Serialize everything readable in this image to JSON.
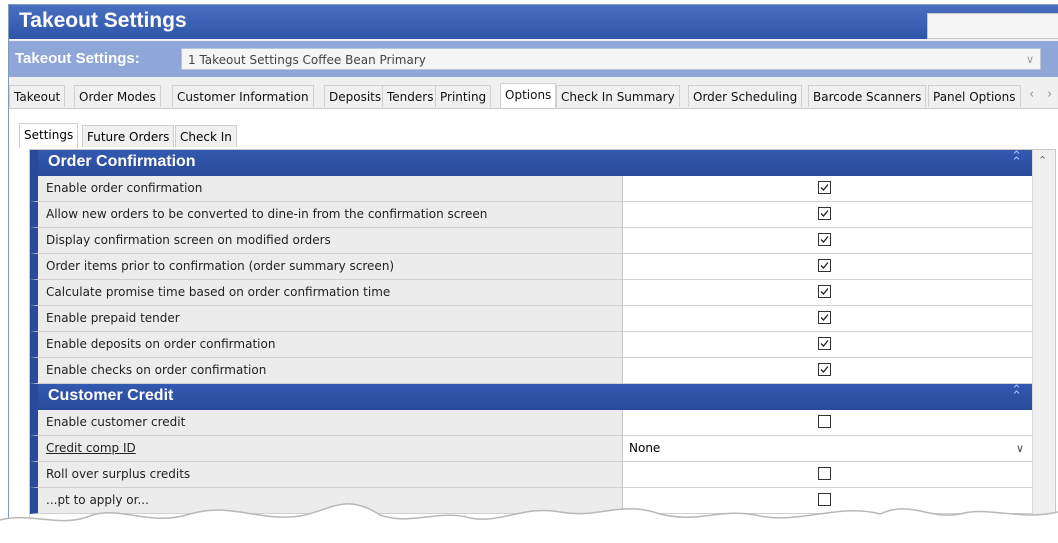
{
  "window": {
    "title": "Takeout Settings"
  },
  "selector": {
    "label": "Takeout Settings:",
    "value": "1 Takeout Settings Coffee Bean Primary"
  },
  "tabs": [
    {
      "label": "Takeout"
    },
    {
      "label": "Order Modes"
    },
    {
      "label": "Customer Information"
    },
    {
      "label": "Deposits"
    },
    {
      "label": "Tenders"
    },
    {
      "label": "Printing"
    },
    {
      "label": "Options",
      "active": true
    },
    {
      "label": "Check In Summary"
    },
    {
      "label": "Order Scheduling"
    },
    {
      "label": "Barcode Scanners"
    },
    {
      "label": "Panel Options"
    }
  ],
  "subtabs": [
    {
      "label": "Settings",
      "active": true
    },
    {
      "label": "Future Orders"
    },
    {
      "label": "Check In"
    }
  ],
  "sections": [
    {
      "title": "Order Confirmation",
      "rows": [
        {
          "label": "Enable order confirmation",
          "type": "checkbox",
          "checked": true
        },
        {
          "label": "Allow new orders to be converted to dine-in from the confirmation screen",
          "type": "checkbox",
          "checked": true
        },
        {
          "label": "Display confirmation screen on modified orders",
          "type": "checkbox",
          "checked": true
        },
        {
          "label": "Order items prior to confirmation (order summary screen)",
          "type": "checkbox",
          "checked": true
        },
        {
          "label": "Calculate promise time based on order confirmation time",
          "type": "checkbox",
          "checked": true
        },
        {
          "label": "Enable prepaid tender",
          "type": "checkbox",
          "checked": true
        },
        {
          "label": "Enable deposits on order confirmation",
          "type": "checkbox",
          "checked": true
        },
        {
          "label": "Enable checks on order confirmation",
          "type": "checkbox",
          "checked": true
        }
      ]
    },
    {
      "title": "Customer Credit",
      "rows": [
        {
          "label": "Enable customer credit",
          "type": "checkbox",
          "checked": false
        },
        {
          "label": "Credit comp ID",
          "type": "dropdown",
          "value": "None"
        },
        {
          "label": "Roll over surplus credits",
          "type": "checkbox",
          "checked": false
        },
        {
          "label": "...pt to apply or...",
          "type": "checkbox",
          "checked": false
        }
      ]
    }
  ],
  "colors": {
    "title_bar": "#2f55aa",
    "section_header": "#3359b0",
    "selector_bar": "#8ea6d8"
  }
}
